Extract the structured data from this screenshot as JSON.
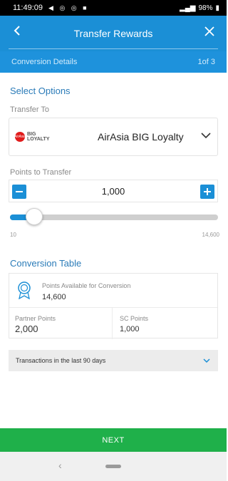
{
  "status_bar": {
    "time": "11:49:09",
    "battery": "98%"
  },
  "header": {
    "title": "Transfer Rewards",
    "back_icon": "chevron-left-icon",
    "close_icon": "close-icon"
  },
  "sub_header": {
    "label": "Conversion Details",
    "step": "1of 3"
  },
  "select_options": {
    "title": "Select Options",
    "transfer_to_label": "Transfer To",
    "partner_name": "AirAsia BIG Loyalty",
    "logo_text_top": "BIG",
    "logo_text_bottom": "LOYALTY",
    "logo_mark": "AirAsia"
  },
  "points": {
    "label": "Points to Transfer",
    "value": "1,000",
    "slider_min": "10",
    "slider_max": "14,600",
    "slider_fraction": 0.068
  },
  "conversion_table": {
    "title": "Conversion Table",
    "available_label": "Points Available for Conversion",
    "available_value": "14,600",
    "partner_points_label": "Partner Points",
    "partner_points_value": "2,000",
    "sc_points_label": "SC Points",
    "sc_points_value": "1,000"
  },
  "transactions": {
    "label": "Transactions in the last 90 days"
  },
  "footer": {
    "next_label": "NEXT"
  },
  "colors": {
    "primary": "#1b8fd6",
    "next_green": "#1fb04a",
    "section_title": "#2a7bb8"
  }
}
